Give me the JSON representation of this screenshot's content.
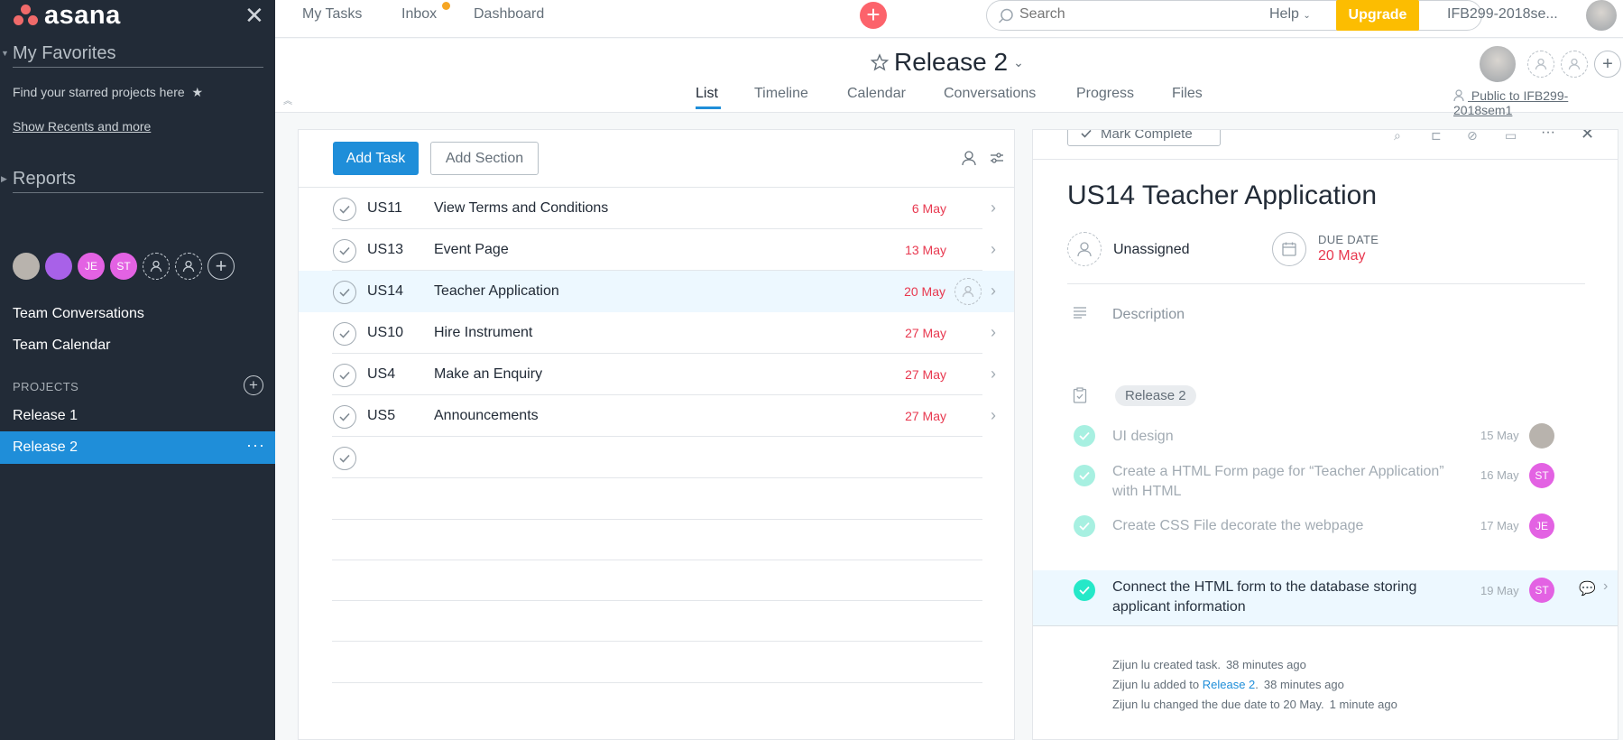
{
  "brand": {
    "name": "asana"
  },
  "sidebar": {
    "favorites_heading": "My Favorites",
    "favorites_hint": "Find your starred projects here",
    "show_recents": "Show Recents and more",
    "reports_heading": "Reports",
    "team_members": [
      {
        "initials": "",
        "color": "#b8b3ad"
      },
      {
        "initials": "",
        "color": "#a861e8"
      },
      {
        "initials": "JE",
        "color": "#e362e3"
      },
      {
        "initials": "ST",
        "color": "#e362e3"
      }
    ],
    "team_conversations": "Team Conversations",
    "team_calendar": "Team Calendar",
    "projects_label": "PROJECTS",
    "projects": [
      {
        "label": "Release 1",
        "active": false
      },
      {
        "label": "Release 2",
        "active": true
      }
    ],
    "more_label": "···"
  },
  "topbar": {
    "nav": [
      "My Tasks",
      "Inbox",
      "Dashboard"
    ],
    "search_placeholder": "Search",
    "help": "Help",
    "upgrade": "Upgrade",
    "workspace": "IFB299-2018se..."
  },
  "project": {
    "title": "Release 2",
    "tabs": [
      "List",
      "Timeline",
      "Calendar",
      "Conversations",
      "Progress",
      "Files"
    ],
    "active_tab": "List",
    "visibility": "Public to IFB299-2018sem1"
  },
  "list": {
    "add_task": "Add Task",
    "add_section": "Add Section",
    "tasks": [
      {
        "id": "US11",
        "name": "View Terms and Conditions",
        "due": "6 May"
      },
      {
        "id": "US13",
        "name": "Event Page",
        "due": "13 May"
      },
      {
        "id": "US14",
        "name": "Teacher Application",
        "due": "20 May",
        "selected": true
      },
      {
        "id": "US10",
        "name": "Hire Instrument",
        "due": "27 May"
      },
      {
        "id": "US4",
        "name": "Make an Enquiry",
        "due": "27 May"
      },
      {
        "id": "US5",
        "name": "Announcements",
        "due": "27 May"
      }
    ]
  },
  "detail": {
    "mark_complete": "Mark Complete",
    "title": "US14   Teacher Application",
    "assignee": "Unassigned",
    "due_label": "DUE DATE",
    "due_value": "20 May",
    "description_placeholder": "Description",
    "project_tag": "Release 2",
    "subtasks": [
      {
        "name": "UI design",
        "date": "15 May",
        "assignee": "",
        "assignee_color": "#b8b3ad",
        "done": true
      },
      {
        "name": "Create a HTML Form page for “Teacher Application” with HTML",
        "date": "16 May",
        "assignee": "ST",
        "assignee_color": "#e362e3",
        "done": true
      },
      {
        "name": "Create CSS File decorate the webpage",
        "date": "17 May",
        "assignee": "JE",
        "assignee_color": "#e362e3",
        "done": true
      },
      {
        "name": "Connect the HTML form to the database storing applicant information",
        "date": "19 May",
        "assignee": "ST",
        "assignee_color": "#e362e3",
        "done": true,
        "active": true
      }
    ],
    "activity": [
      {
        "text": "Zijun lu created task.",
        "link": "",
        "suffix": "",
        "time": "38 minutes ago"
      },
      {
        "text": "Zijun lu added to ",
        "link": "Release 2",
        "suffix": ".",
        "time": "38 minutes ago"
      },
      {
        "text": "Zijun lu changed the due date to 20 May.",
        "link": "",
        "suffix": "",
        "time": "1 minute ago"
      }
    ]
  },
  "colors": {
    "sidebar_bg": "#222b37",
    "accent_blue": "#1f8ed9",
    "due_red": "#e8384f",
    "upgrade_yellow": "#fcbd01",
    "complete_green": "#25e8c8"
  }
}
